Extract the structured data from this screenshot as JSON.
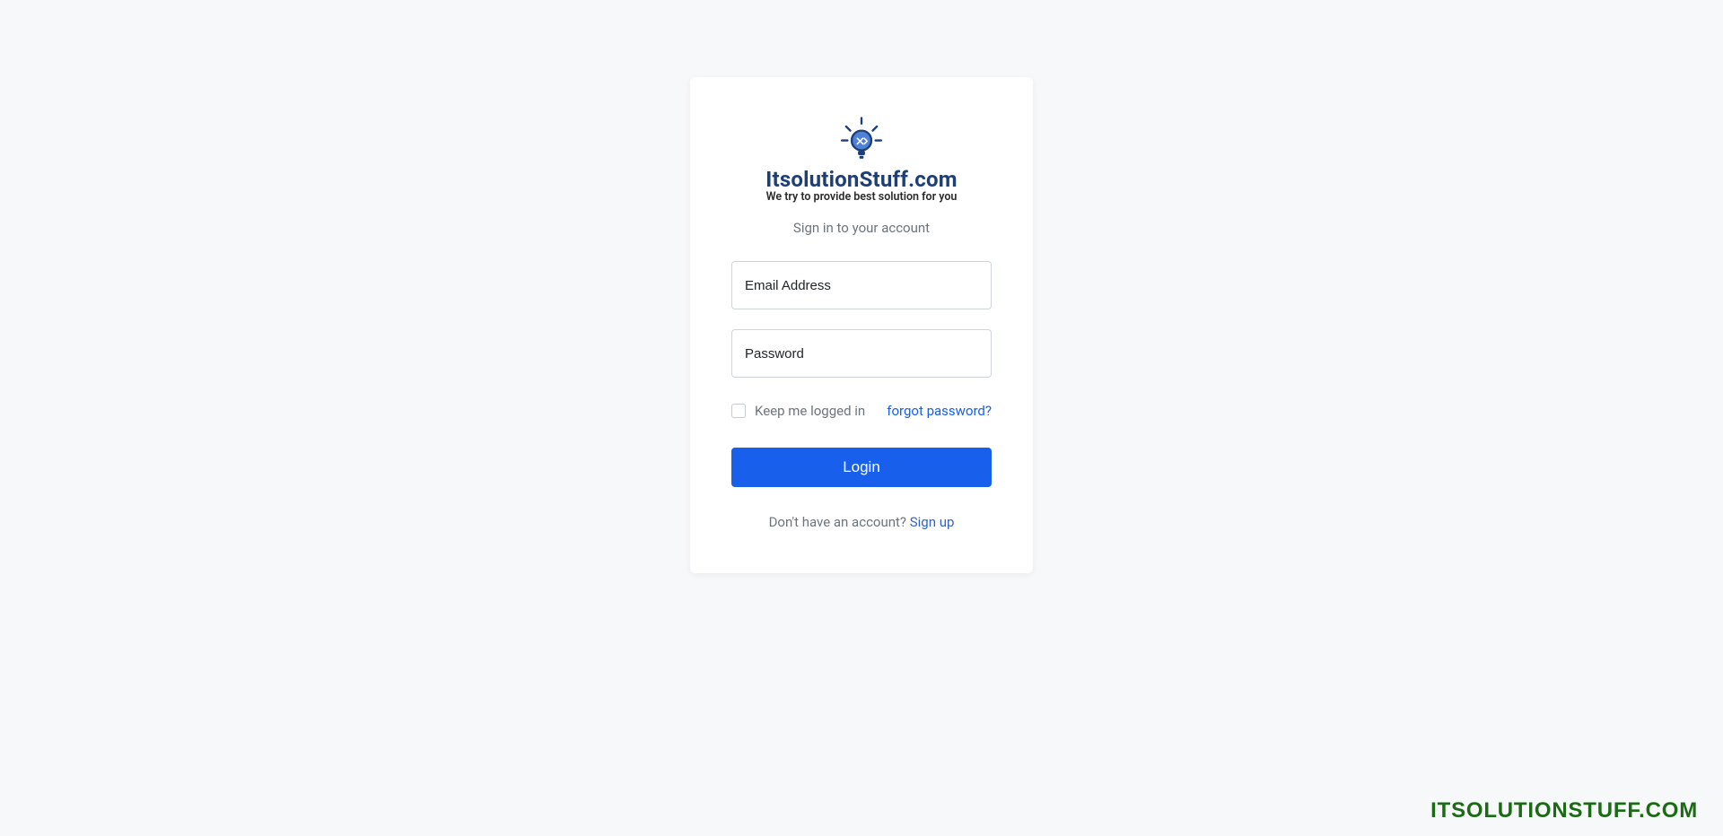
{
  "brand": {
    "title": "ItsolutionStuff.com",
    "subtitle": "We try to provide best solution for you"
  },
  "signin_text": "Sign in to your account",
  "inputs": {
    "email_placeholder": "Email Address",
    "password_placeholder": "Password"
  },
  "options": {
    "remember_label": "Keep me logged in",
    "forgot_label": "forgot password?"
  },
  "login_button": "Login",
  "signup": {
    "prompt": "Don't have an account? ",
    "link": "Sign up"
  },
  "watermark": "ITSOLUTIONSTUFF.COM"
}
